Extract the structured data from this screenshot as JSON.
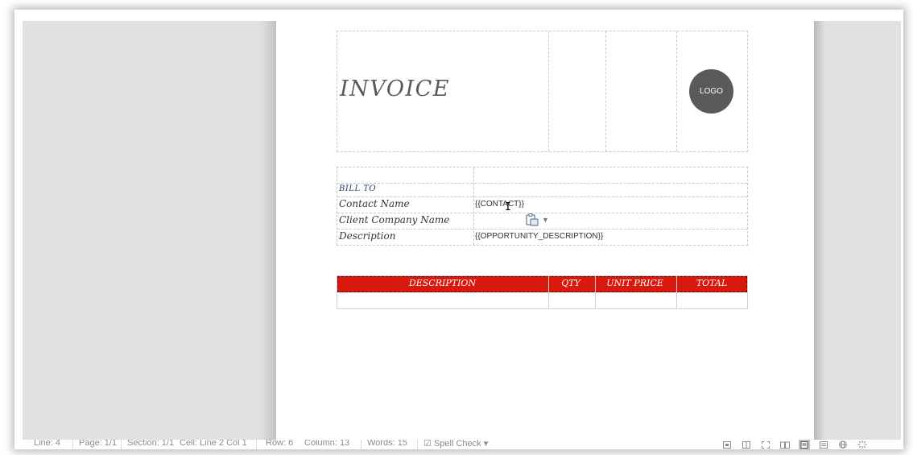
{
  "document": {
    "title": "INVOICE",
    "logo_label": "LOGO",
    "bill_to": {
      "heading": "BILL TO",
      "rows": [
        {
          "label": "Contact Name",
          "value": "{{CONTACT}}"
        },
        {
          "label": "Client Company Name",
          "value": ""
        },
        {
          "label": "Description",
          "value": "{{OPPORTUNITY_DESCRIPTION}}"
        }
      ]
    },
    "items_table": {
      "columns": [
        "DESCRIPTION",
        "QTY",
        "UNIT PRICE",
        "TOTAL"
      ],
      "header_color": "#d9190d"
    }
  },
  "context_icons": {
    "paste_options": "paste-options-icon"
  },
  "status_bar": {
    "items": [
      "Line: 4",
      "Page: 1/1",
      "Section: 1/1",
      "Cell: Line 2 Col 1",
      "Row: 6",
      "Column: 13",
      "Words: 15"
    ],
    "spell_check": "Spell Check",
    "view_icons": [
      "normal-view-icon",
      "page-view-icon",
      "full-screen-icon",
      "reading-view-icon",
      "print-layout-icon",
      "outline-view-icon",
      "web-layout-icon",
      "settings-icon"
    ]
  },
  "colors": {
    "accent_red": "#d9190d",
    "logo_gray": "#5a5a5a",
    "pasteboard_gray": "#e1e1e1"
  }
}
